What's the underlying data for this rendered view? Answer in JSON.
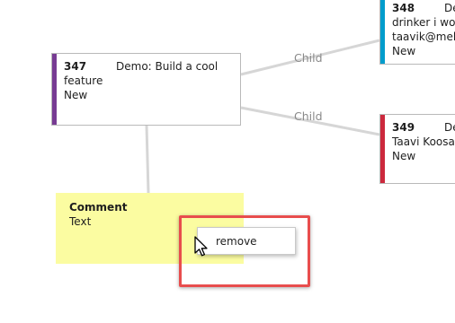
{
  "work_items": [
    {
      "id": "347",
      "title": "Demo: Build a cool",
      "line2": "feature",
      "state": "New",
      "color": "#773b93"
    },
    {
      "id": "348",
      "title": "De",
      "line2": "drinker i woul",
      "line3": "taavik@melbo",
      "state": "New",
      "color": "#009ccc"
    },
    {
      "id": "349",
      "title": "De",
      "line2": "Taavi Koosaar",
      "state": "New",
      "color": "#cc293d"
    }
  ],
  "links": [
    {
      "label": "Child"
    },
    {
      "label": "Child"
    }
  ],
  "comment_note": {
    "title": "Comment",
    "body": "Text",
    "color": "#fbfca1"
  },
  "context_menu": {
    "items": [
      {
        "label": "remove"
      }
    ]
  },
  "highlight_color": "#e84d4d",
  "icons": {
    "cursor": "mouse-pointer-icon"
  }
}
